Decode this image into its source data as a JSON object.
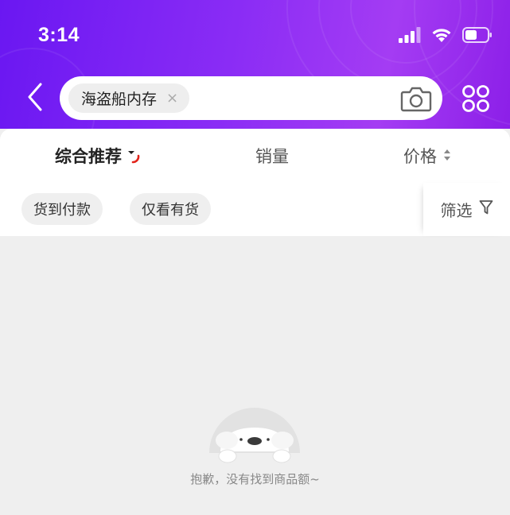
{
  "status_bar": {
    "time": "3:14",
    "icons": [
      "signal-icon",
      "wifi-icon",
      "battery-icon"
    ]
  },
  "search": {
    "query_chip": "海盗船内存",
    "chip_close": "×",
    "icons": [
      "back-arrow-icon",
      "camera-icon",
      "apps-grid-icon"
    ]
  },
  "sort_tabs": [
    {
      "label": "综合推荐",
      "active": true
    },
    {
      "label": "销量",
      "active": false
    },
    {
      "label": "价格",
      "active": false
    }
  ],
  "filters": {
    "chips": [
      "货到付款",
      "仅看有货"
    ],
    "filter_button": "筛选"
  },
  "empty_state": {
    "message": "抱歉，没有找到商品额~"
  },
  "colors": {
    "header_gradient_start": "#6a17f2",
    "header_gradient_end": "#a43cf3",
    "accent_red": "#e2231a",
    "background": "#efefef"
  }
}
